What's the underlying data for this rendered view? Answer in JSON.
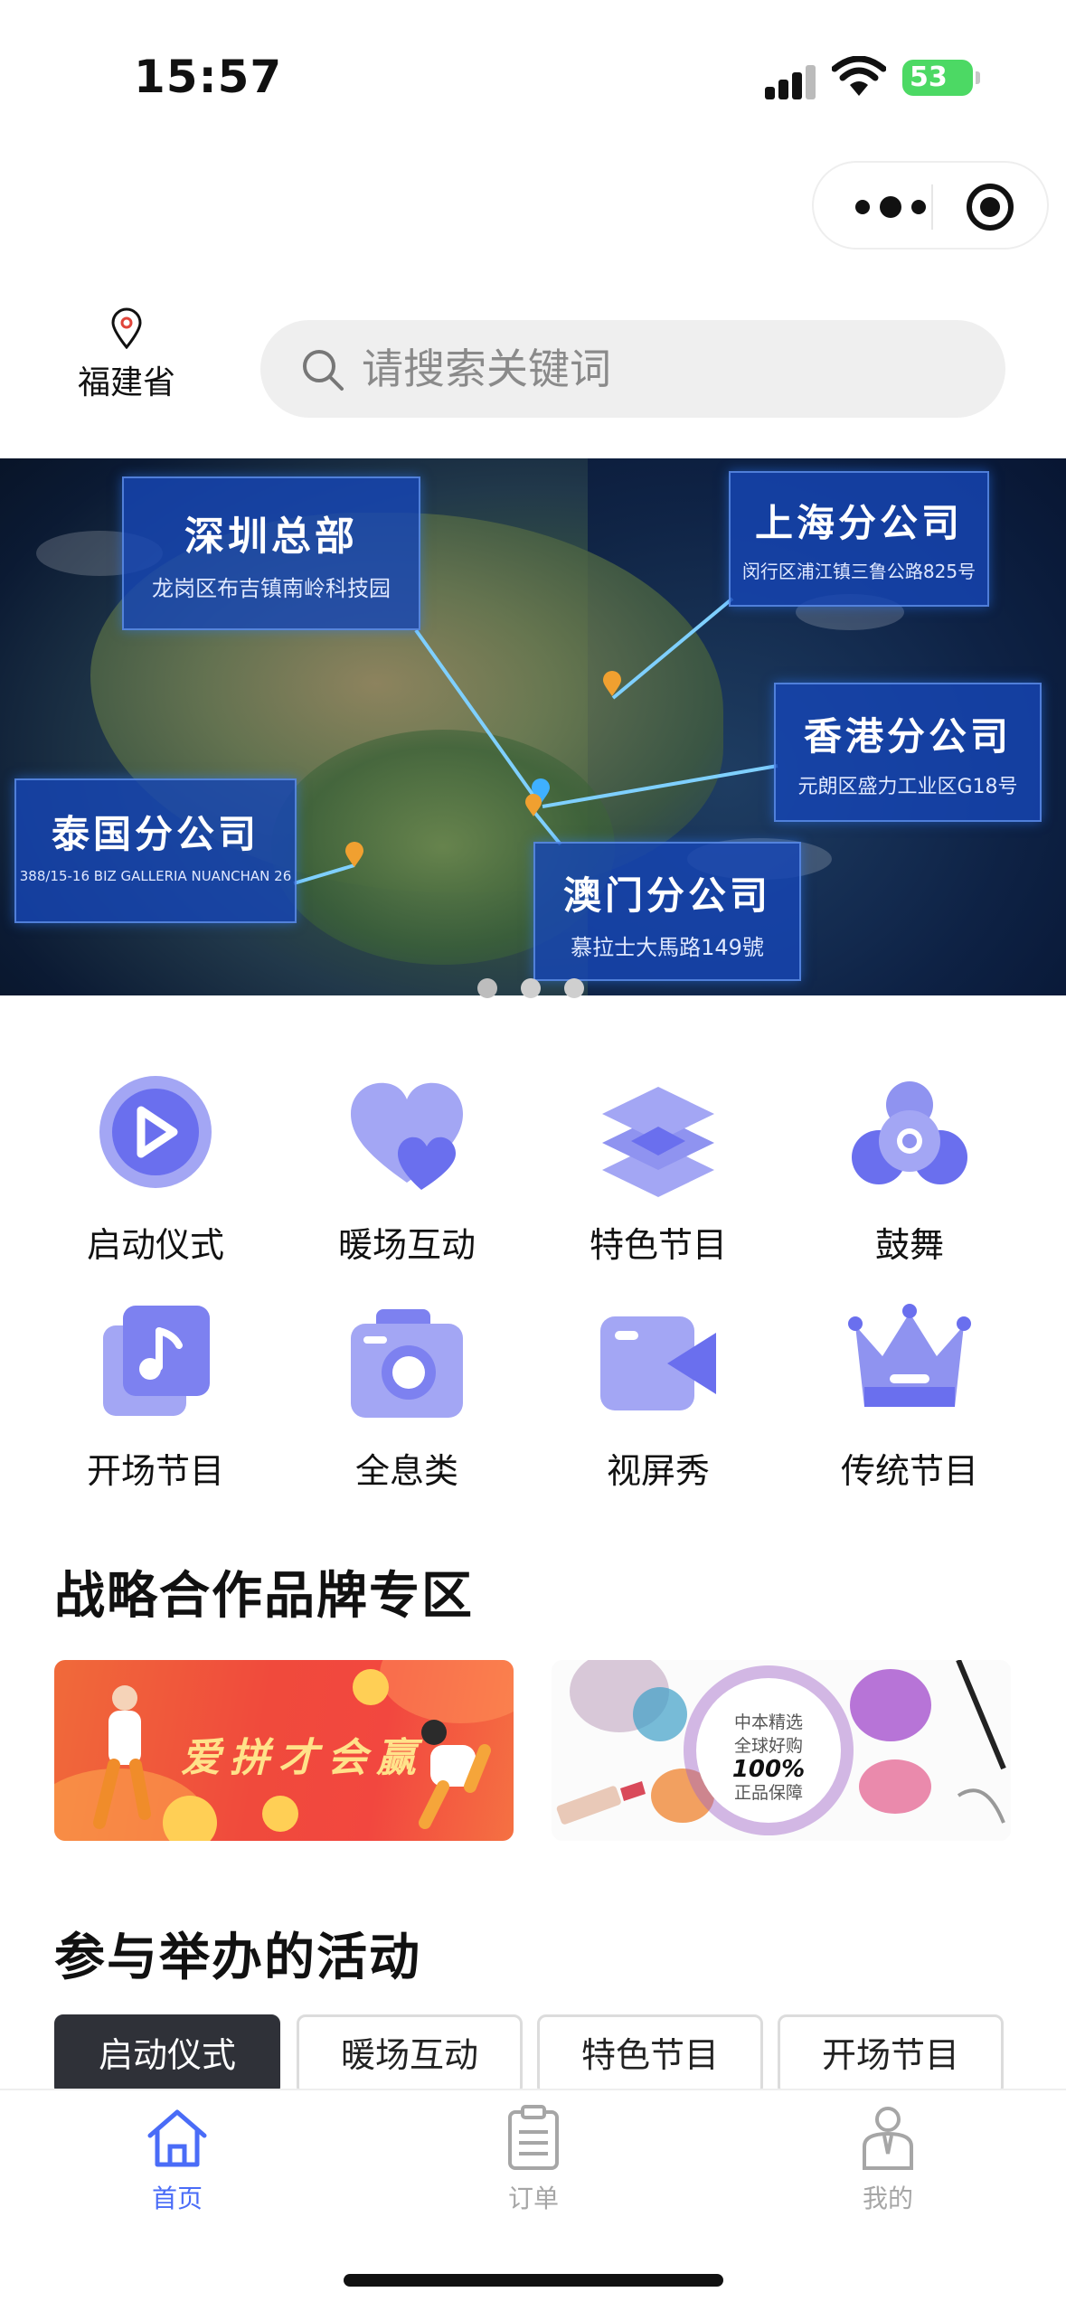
{
  "status_bar": {
    "time": "15:57",
    "battery": "53"
  },
  "location": {
    "label": "福建省"
  },
  "search": {
    "placeholder": "请搜索关键词"
  },
  "banner": {
    "offices": [
      {
        "name": "深圳总部",
        "address": "龙岗区布吉镇南岭科技园"
      },
      {
        "name": "上海分公司",
        "address": "闵行区浦江镇三鲁公路825号"
      },
      {
        "name": "香港分公司",
        "address": "元朗区盛力工业区G18号"
      },
      {
        "name": "泰国分公司",
        "address": "388/15-16 BIZ GALLERIA NUANCHAN 26"
      },
      {
        "name": "澳门分公司",
        "address": "慕拉士大馬路149號"
      }
    ],
    "page_count": 3,
    "active_page": 1
  },
  "categories": [
    {
      "label": "启动仪式",
      "icon": "play-circle-icon"
    },
    {
      "label": "暖场互动",
      "icon": "hearts-icon"
    },
    {
      "label": "特色节目",
      "icon": "layers-icon"
    },
    {
      "label": "鼓舞",
      "icon": "drum-icon"
    },
    {
      "label": "开场节目",
      "icon": "music-note-icon"
    },
    {
      "label": "全息类",
      "icon": "camera-icon"
    },
    {
      "label": "视屏秀",
      "icon": "video-camera-icon"
    },
    {
      "label": "传统节目",
      "icon": "crown-icon"
    }
  ],
  "brand_section": {
    "title": "战略合作品牌专区",
    "cards": [
      {
        "text": "爱拼才会赢"
      },
      {
        "lines": [
          "中本精选",
          "全球好购",
          "100%",
          "正品保障"
        ]
      }
    ]
  },
  "activity_section": {
    "title": "参与举办的活动",
    "tabs": [
      "启动仪式",
      "暖场互动",
      "特色节目",
      "开场节目"
    ],
    "active_tab": 0
  },
  "tab_bar": {
    "items": [
      {
        "label": "首页",
        "icon": "home-icon",
        "active": true
      },
      {
        "label": "订单",
        "icon": "clipboard-icon",
        "active": false
      },
      {
        "label": "我的",
        "icon": "user-icon",
        "active": false
      }
    ]
  },
  "colors": {
    "accent": "#4a6cf7",
    "icon_purple": "#8f93f0",
    "inactive": "#a6a6a6"
  }
}
